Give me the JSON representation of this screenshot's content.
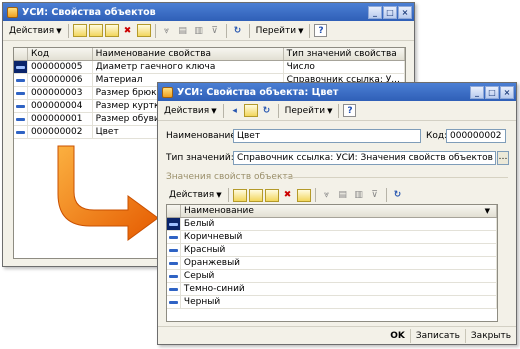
{
  "back_window": {
    "title": "УСИ: Свойства объектов",
    "toolbar": {
      "actions_label": "Действия",
      "goto_label": "Перейти",
      "help_label": "?"
    },
    "columns": [
      "Код",
      "Наименование свойства",
      "Тип значений свойства"
    ],
    "rows": [
      {
        "code": "000000005",
        "name": "Диаметр гаечного ключа",
        "type": "Число"
      },
      {
        "code": "000000006",
        "name": "Материал",
        "type": "Справочник ссылка: У..."
      },
      {
        "code": "000000003",
        "name": "Размер брюк",
        "type": ""
      },
      {
        "code": "000000004",
        "name": "Размер куртки",
        "type": ""
      },
      {
        "code": "000000001",
        "name": "Размер обуви",
        "type": ""
      },
      {
        "code": "000000002",
        "name": "Цвет",
        "type": ""
      }
    ]
  },
  "front_window": {
    "title": "УСИ: Свойства объекта: Цвет",
    "toolbar": {
      "actions_label": "Действия",
      "goto_label": "Перейти",
      "help_label": "?"
    },
    "name_label": "Наименование:",
    "name_value": "Цвет",
    "code_label": "Код:",
    "code_value": "000000002",
    "type_label": "Тип значений:",
    "type_value": "Справочник ссылка: УСИ: Значения свойств объектов",
    "section_title": "Значения свойств объекта",
    "inner_toolbar": {
      "actions_label": "Действия"
    },
    "values_column": "Наименование",
    "values": [
      "Белый",
      "Коричневый",
      "Красный",
      "Оранжевый",
      "Серый",
      "Темно-синий",
      "Черный"
    ],
    "buttons": {
      "ok": "OK",
      "save": "Записать",
      "close": "Закрыть"
    }
  },
  "colors": {
    "titlebar": "#2f5fb7",
    "arrow": "#f07c10",
    "window_bg": "#f3f1e8"
  }
}
